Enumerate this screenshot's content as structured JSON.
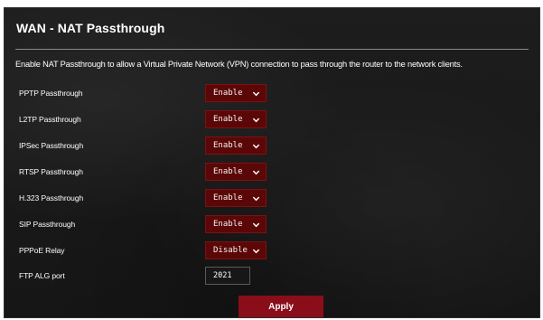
{
  "page": {
    "title": "WAN - NAT Passthrough",
    "description": "Enable NAT Passthrough to allow a Virtual Private Network (VPN) connection to pass through the router to the network clients."
  },
  "settings": [
    {
      "label": "PPTP Passthrough",
      "value": "Enable"
    },
    {
      "label": "L2TP Passthrough",
      "value": "Enable"
    },
    {
      "label": "IPSec Passthrough",
      "value": "Enable"
    },
    {
      "label": "RTSP Passthrough",
      "value": "Enable"
    },
    {
      "label": "H.323 Passthrough",
      "value": "Enable"
    },
    {
      "label": "SIP Passthrough",
      "value": "Enable"
    },
    {
      "label": "PPPoE Relay",
      "value": "Disable"
    }
  ],
  "ftp_alg": {
    "label": "FTP ALG port",
    "value": "2021"
  },
  "apply_label": "Apply",
  "icons": {
    "dropdown": "chevron-down-icon"
  },
  "colors": {
    "panel_background": "#1a1a1a",
    "select_background": "#5c0707",
    "apply_button": "#8a0d1a",
    "text": "#ffffff"
  }
}
